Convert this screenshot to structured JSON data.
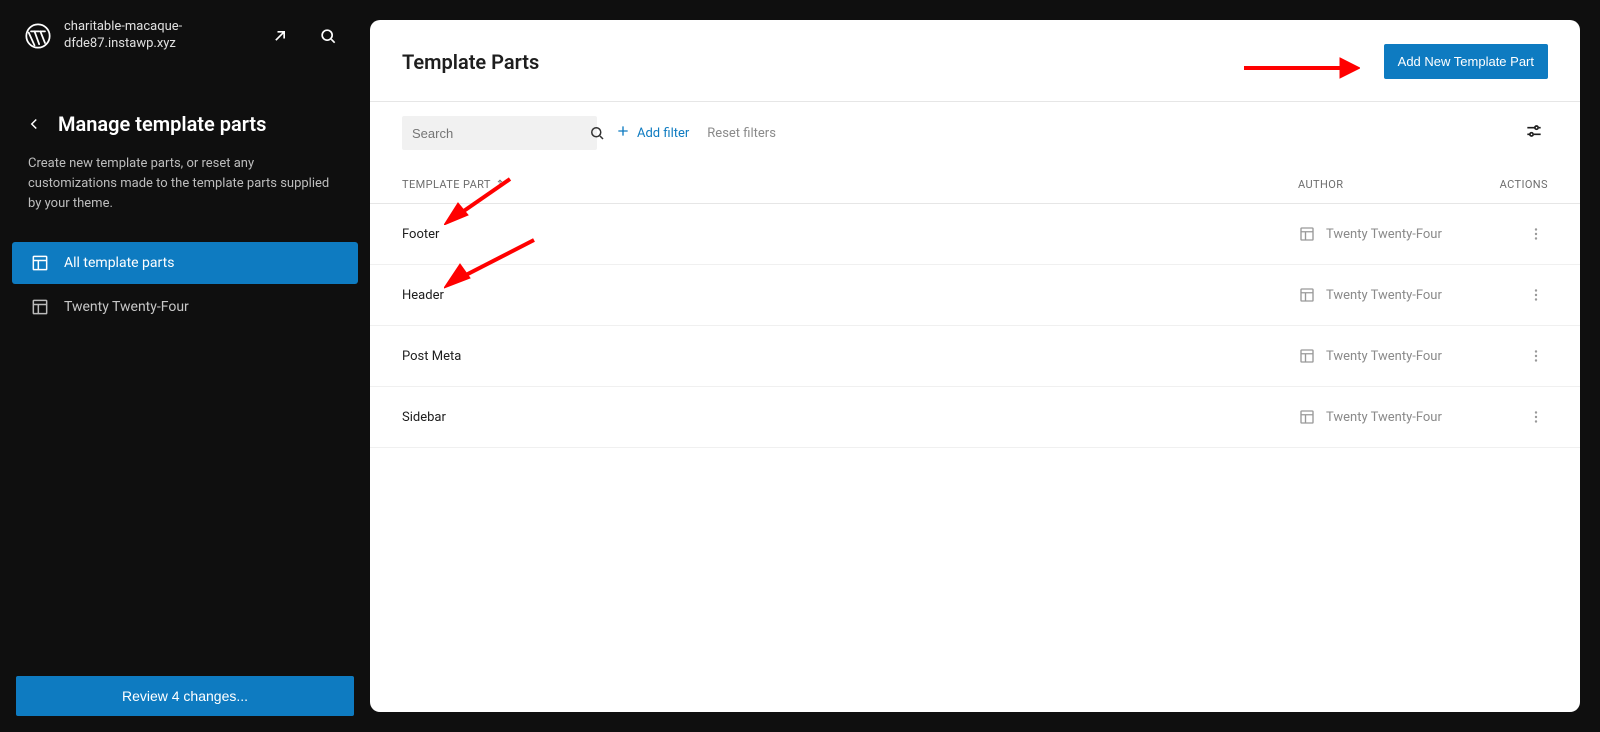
{
  "site_name": "charitable-macaque-dfde87.instawp.xyz",
  "sidebar": {
    "title": "Manage template parts",
    "description": "Create new template parts, or reset any customizations made to the template parts supplied by your theme.",
    "items": [
      {
        "label": "All template parts",
        "active": true
      },
      {
        "label": "Twenty Twenty-Four",
        "active": false
      }
    ],
    "review_button": "Review 4 changes..."
  },
  "main": {
    "title": "Template Parts",
    "add_button": "Add New Template Part",
    "search_placeholder": "Search",
    "add_filter": "Add filter",
    "reset_filters": "Reset filters",
    "columns": {
      "name": "TEMPLATE PART",
      "author": "AUTHOR",
      "actions": "ACTIONS"
    },
    "rows": [
      {
        "name": "Footer",
        "author": "Twenty Twenty-Four"
      },
      {
        "name": "Header",
        "author": "Twenty Twenty-Four"
      },
      {
        "name": "Post Meta",
        "author": "Twenty Twenty-Four"
      },
      {
        "name": "Sidebar",
        "author": "Twenty Twenty-Four"
      }
    ]
  }
}
